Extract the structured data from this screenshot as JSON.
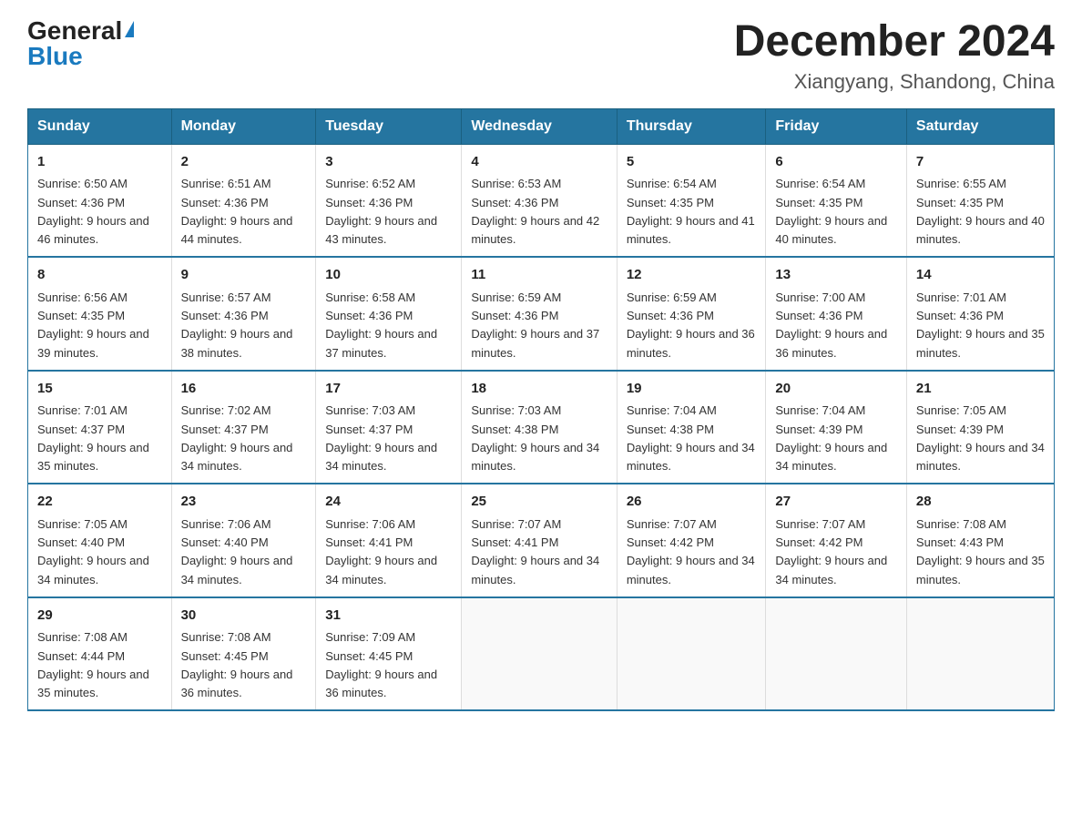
{
  "header": {
    "logo_general": "General",
    "logo_blue": "Blue",
    "month_year": "December 2024",
    "location": "Xiangyang, Shandong, China"
  },
  "weekdays": [
    "Sunday",
    "Monday",
    "Tuesday",
    "Wednesday",
    "Thursday",
    "Friday",
    "Saturday"
  ],
  "weeks": [
    [
      {
        "day": "1",
        "sunrise": "6:50 AM",
        "sunset": "4:36 PM",
        "daylight": "9 hours and 46 minutes."
      },
      {
        "day": "2",
        "sunrise": "6:51 AM",
        "sunset": "4:36 PM",
        "daylight": "9 hours and 44 minutes."
      },
      {
        "day": "3",
        "sunrise": "6:52 AM",
        "sunset": "4:36 PM",
        "daylight": "9 hours and 43 minutes."
      },
      {
        "day": "4",
        "sunrise": "6:53 AM",
        "sunset": "4:36 PM",
        "daylight": "9 hours and 42 minutes."
      },
      {
        "day": "5",
        "sunrise": "6:54 AM",
        "sunset": "4:35 PM",
        "daylight": "9 hours and 41 minutes."
      },
      {
        "day": "6",
        "sunrise": "6:54 AM",
        "sunset": "4:35 PM",
        "daylight": "9 hours and 40 minutes."
      },
      {
        "day": "7",
        "sunrise": "6:55 AM",
        "sunset": "4:35 PM",
        "daylight": "9 hours and 40 minutes."
      }
    ],
    [
      {
        "day": "8",
        "sunrise": "6:56 AM",
        "sunset": "4:35 PM",
        "daylight": "9 hours and 39 minutes."
      },
      {
        "day": "9",
        "sunrise": "6:57 AM",
        "sunset": "4:36 PM",
        "daylight": "9 hours and 38 minutes."
      },
      {
        "day": "10",
        "sunrise": "6:58 AM",
        "sunset": "4:36 PM",
        "daylight": "9 hours and 37 minutes."
      },
      {
        "day": "11",
        "sunrise": "6:59 AM",
        "sunset": "4:36 PM",
        "daylight": "9 hours and 37 minutes."
      },
      {
        "day": "12",
        "sunrise": "6:59 AM",
        "sunset": "4:36 PM",
        "daylight": "9 hours and 36 minutes."
      },
      {
        "day": "13",
        "sunrise": "7:00 AM",
        "sunset": "4:36 PM",
        "daylight": "9 hours and 36 minutes."
      },
      {
        "day": "14",
        "sunrise": "7:01 AM",
        "sunset": "4:36 PM",
        "daylight": "9 hours and 35 minutes."
      }
    ],
    [
      {
        "day": "15",
        "sunrise": "7:01 AM",
        "sunset": "4:37 PM",
        "daylight": "9 hours and 35 minutes."
      },
      {
        "day": "16",
        "sunrise": "7:02 AM",
        "sunset": "4:37 PM",
        "daylight": "9 hours and 34 minutes."
      },
      {
        "day": "17",
        "sunrise": "7:03 AM",
        "sunset": "4:37 PM",
        "daylight": "9 hours and 34 minutes."
      },
      {
        "day": "18",
        "sunrise": "7:03 AM",
        "sunset": "4:38 PM",
        "daylight": "9 hours and 34 minutes."
      },
      {
        "day": "19",
        "sunrise": "7:04 AM",
        "sunset": "4:38 PM",
        "daylight": "9 hours and 34 minutes."
      },
      {
        "day": "20",
        "sunrise": "7:04 AM",
        "sunset": "4:39 PM",
        "daylight": "9 hours and 34 minutes."
      },
      {
        "day": "21",
        "sunrise": "7:05 AM",
        "sunset": "4:39 PM",
        "daylight": "9 hours and 34 minutes."
      }
    ],
    [
      {
        "day": "22",
        "sunrise": "7:05 AM",
        "sunset": "4:40 PM",
        "daylight": "9 hours and 34 minutes."
      },
      {
        "day": "23",
        "sunrise": "7:06 AM",
        "sunset": "4:40 PM",
        "daylight": "9 hours and 34 minutes."
      },
      {
        "day": "24",
        "sunrise": "7:06 AM",
        "sunset": "4:41 PM",
        "daylight": "9 hours and 34 minutes."
      },
      {
        "day": "25",
        "sunrise": "7:07 AM",
        "sunset": "4:41 PM",
        "daylight": "9 hours and 34 minutes."
      },
      {
        "day": "26",
        "sunrise": "7:07 AM",
        "sunset": "4:42 PM",
        "daylight": "9 hours and 34 minutes."
      },
      {
        "day": "27",
        "sunrise": "7:07 AM",
        "sunset": "4:42 PM",
        "daylight": "9 hours and 34 minutes."
      },
      {
        "day": "28",
        "sunrise": "7:08 AM",
        "sunset": "4:43 PM",
        "daylight": "9 hours and 35 minutes."
      }
    ],
    [
      {
        "day": "29",
        "sunrise": "7:08 AM",
        "sunset": "4:44 PM",
        "daylight": "9 hours and 35 minutes."
      },
      {
        "day": "30",
        "sunrise": "7:08 AM",
        "sunset": "4:45 PM",
        "daylight": "9 hours and 36 minutes."
      },
      {
        "day": "31",
        "sunrise": "7:09 AM",
        "sunset": "4:45 PM",
        "daylight": "9 hours and 36 minutes."
      },
      null,
      null,
      null,
      null
    ]
  ]
}
